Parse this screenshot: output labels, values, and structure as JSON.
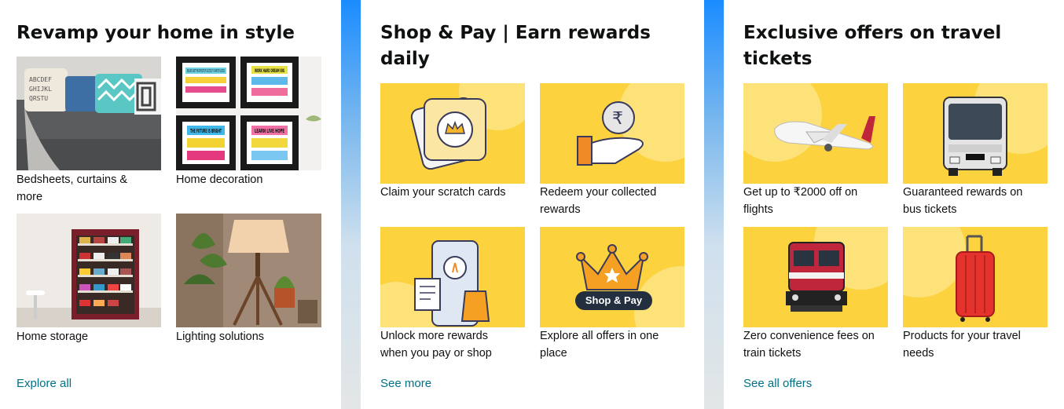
{
  "cards": [
    {
      "title": "Revamp your home in style",
      "tiles": [
        {
          "label": "Bedsheets, curtains & more"
        },
        {
          "label": "Home decoration"
        },
        {
          "label": "Home storage"
        },
        {
          "label": "Lighting solutions"
        }
      ],
      "link": "Explore all"
    },
    {
      "title": "Shop & Pay | Earn rewards daily",
      "tiles": [
        {
          "label": "Claim your scratch cards"
        },
        {
          "label": "Redeem your collected rewards"
        },
        {
          "label": "Unlock more rewards when you pay or shop"
        },
        {
          "label": "Explore all offers in one place"
        }
      ],
      "link": "See more",
      "badge": "Shop & Pay"
    },
    {
      "title": "Exclusive offers on travel tickets",
      "tiles": [
        {
          "label": "Get up to ₹2000 off on flights"
        },
        {
          "label": "Guaranteed rewards on bus tickets"
        },
        {
          "label": "Zero convenience fees on train tickets"
        },
        {
          "label": "Products for your travel needs"
        }
      ],
      "link": "See all offers"
    }
  ],
  "decor_posters": {
    "p1": "FAILURE IS NOT THE OPPOSITE OF SUCCESS IT IS PART OF SUCCESS",
    "p2": "WORK HARD DREAM BIG",
    "p3": "THE FUTURE IS BRIGHT",
    "p4": "LEARN LIVE HOPE"
  },
  "rupee_symbol": "₹",
  "colors": {
    "link": "#007185",
    "tile_bg": "#fdd23f",
    "badge": "#232f3e",
    "accent_strip": "#1a8cff"
  }
}
